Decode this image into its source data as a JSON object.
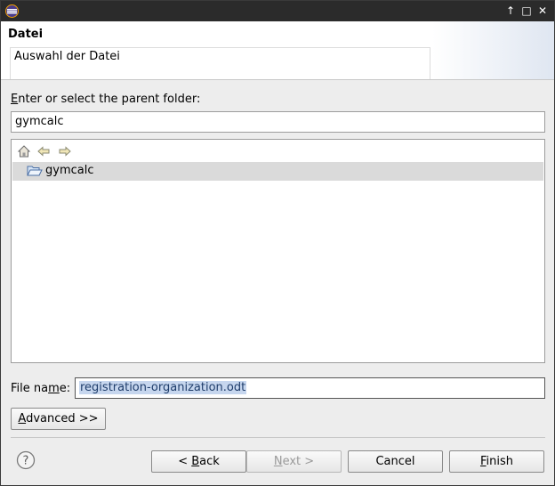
{
  "window": {
    "title": ""
  },
  "header": {
    "title": "Datei",
    "message": "Auswahl der Datei"
  },
  "folder_section": {
    "label_mnemonic": "E",
    "label_rest": "nter or select the parent folder:",
    "folder_value": "gymcalc",
    "tree_items": [
      {
        "label": "gymcalc",
        "icon": "open-folder-icon"
      }
    ]
  },
  "file_name": {
    "label_pre": "File na",
    "label_mnemonic": "m",
    "label_post": "e:",
    "value": "registration-organization.odt"
  },
  "advanced_button": {
    "mnemonic": "A",
    "rest": "dvanced >>"
  },
  "footer": {
    "back": {
      "prefix": "< ",
      "mnemonic": "B",
      "rest": "ack"
    },
    "next": {
      "mnemonic": "N",
      "rest": "ext >"
    },
    "cancel": "Cancel",
    "finish": {
      "mnemonic": "F",
      "rest": "inish"
    }
  },
  "colors": {
    "titlebar": "#2b2b2b",
    "selection": "#c6d6ee",
    "tree_row_selected": "#dadada"
  },
  "icons": [
    "eclipse-app-icon",
    "maximize-up-icon",
    "restore-icon",
    "close-icon",
    "home-icon",
    "back-arrow-icon",
    "forward-arrow-icon",
    "open-folder-icon",
    "help-icon"
  ]
}
